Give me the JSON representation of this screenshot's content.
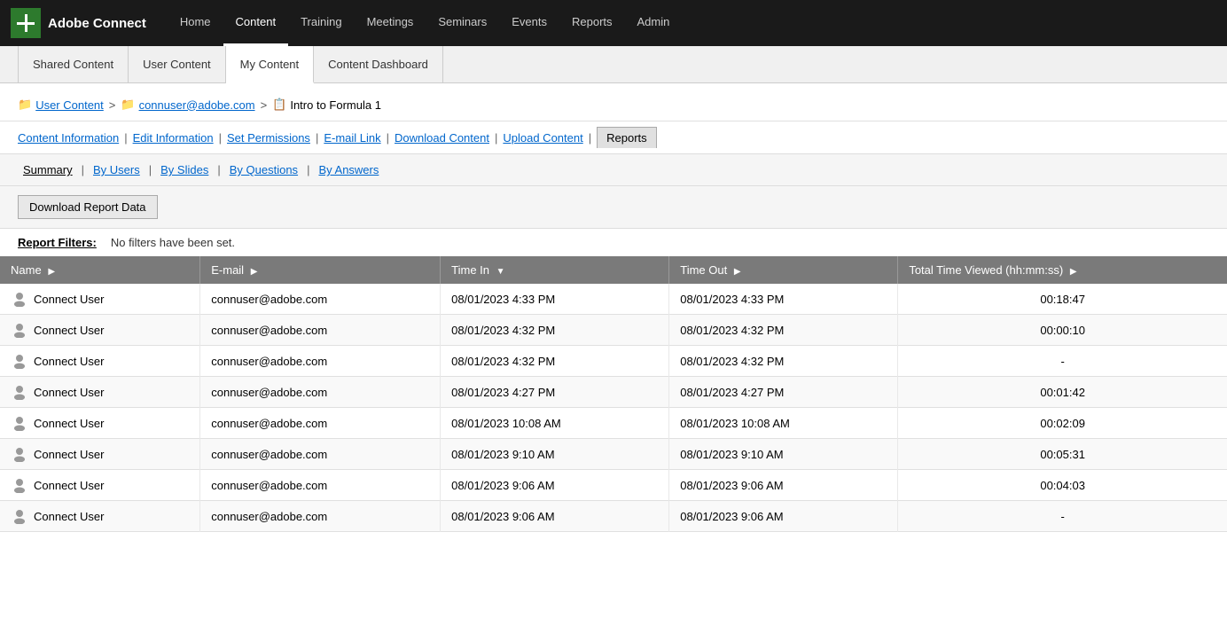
{
  "app": {
    "name": "Adobe Connect"
  },
  "nav": {
    "items": [
      {
        "label": "Home",
        "active": false
      },
      {
        "label": "Content",
        "active": true
      },
      {
        "label": "Training",
        "active": false
      },
      {
        "label": "Meetings",
        "active": false
      },
      {
        "label": "Seminars",
        "active": false
      },
      {
        "label": "Events",
        "active": false
      },
      {
        "label": "Reports",
        "active": false
      },
      {
        "label": "Admin",
        "active": false
      }
    ]
  },
  "tabs": {
    "items": [
      {
        "label": "Shared Content",
        "active": false
      },
      {
        "label": "User Content",
        "active": false
      },
      {
        "label": "My Content",
        "active": true
      },
      {
        "label": "Content Dashboard",
        "active": false
      }
    ]
  },
  "breadcrumb": {
    "items": [
      {
        "label": "User Content",
        "link": true
      },
      {
        "label": "connuser@adobe.com",
        "link": true
      },
      {
        "label": "Intro to Formula 1",
        "link": false
      }
    ]
  },
  "action_links": {
    "items": [
      {
        "label": "Content Information",
        "active": false
      },
      {
        "label": "Edit Information",
        "active": false
      },
      {
        "label": "Set Permissions",
        "active": false
      },
      {
        "label": "E-mail Link",
        "active": false
      },
      {
        "label": "Download Content",
        "active": false
      },
      {
        "label": "Upload Content",
        "active": false
      },
      {
        "label": "Reports",
        "active": true
      }
    ]
  },
  "sub_tabs": {
    "items": [
      {
        "label": "Summary",
        "active": true
      },
      {
        "label": "By Users",
        "active": false
      },
      {
        "label": "By Slides",
        "active": false
      },
      {
        "label": "By Questions",
        "active": false
      },
      {
        "label": "By Answers",
        "active": false
      }
    ]
  },
  "buttons": {
    "download_report": "Download Report Data"
  },
  "report_filters": {
    "label": "Report Filters:",
    "status": "No filters have been set."
  },
  "table": {
    "columns": [
      {
        "label": "Name",
        "sort": "▶"
      },
      {
        "label": "E-mail",
        "sort": "▶"
      },
      {
        "label": "Time In",
        "sort": "▼"
      },
      {
        "label": "Time Out",
        "sort": "▶"
      },
      {
        "label": "Total Time Viewed (hh:mm:ss)",
        "sort": "▶"
      }
    ],
    "rows": [
      {
        "name": "Connect User",
        "email": "connuser@adobe.com",
        "time_in": "08/01/2023 4:33 PM",
        "time_out": "08/01/2023 4:33 PM",
        "total_time": "00:18:47"
      },
      {
        "name": "Connect User",
        "email": "connuser@adobe.com",
        "time_in": "08/01/2023 4:32 PM",
        "time_out": "08/01/2023 4:32 PM",
        "total_time": "00:00:10"
      },
      {
        "name": "Connect User",
        "email": "connuser@adobe.com",
        "time_in": "08/01/2023 4:32 PM",
        "time_out": "08/01/2023 4:32 PM",
        "total_time": "-"
      },
      {
        "name": "Connect User",
        "email": "connuser@adobe.com",
        "time_in": "08/01/2023 4:27 PM",
        "time_out": "08/01/2023 4:27 PM",
        "total_time": "00:01:42"
      },
      {
        "name": "Connect User",
        "email": "connuser@adobe.com",
        "time_in": "08/01/2023 10:08 AM",
        "time_out": "08/01/2023 10:08 AM",
        "total_time": "00:02:09"
      },
      {
        "name": "Connect User",
        "email": "connuser@adobe.com",
        "time_in": "08/01/2023 9:10 AM",
        "time_out": "08/01/2023 9:10 AM",
        "total_time": "00:05:31"
      },
      {
        "name": "Connect User",
        "email": "connuser@adobe.com",
        "time_in": "08/01/2023 9:06 AM",
        "time_out": "08/01/2023 9:06 AM",
        "total_time": "00:04:03"
      },
      {
        "name": "Connect User",
        "email": "connuser@adobe.com",
        "time_in": "08/01/2023 9:06 AM",
        "time_out": "08/01/2023 9:06 AM",
        "total_time": "-"
      }
    ]
  }
}
